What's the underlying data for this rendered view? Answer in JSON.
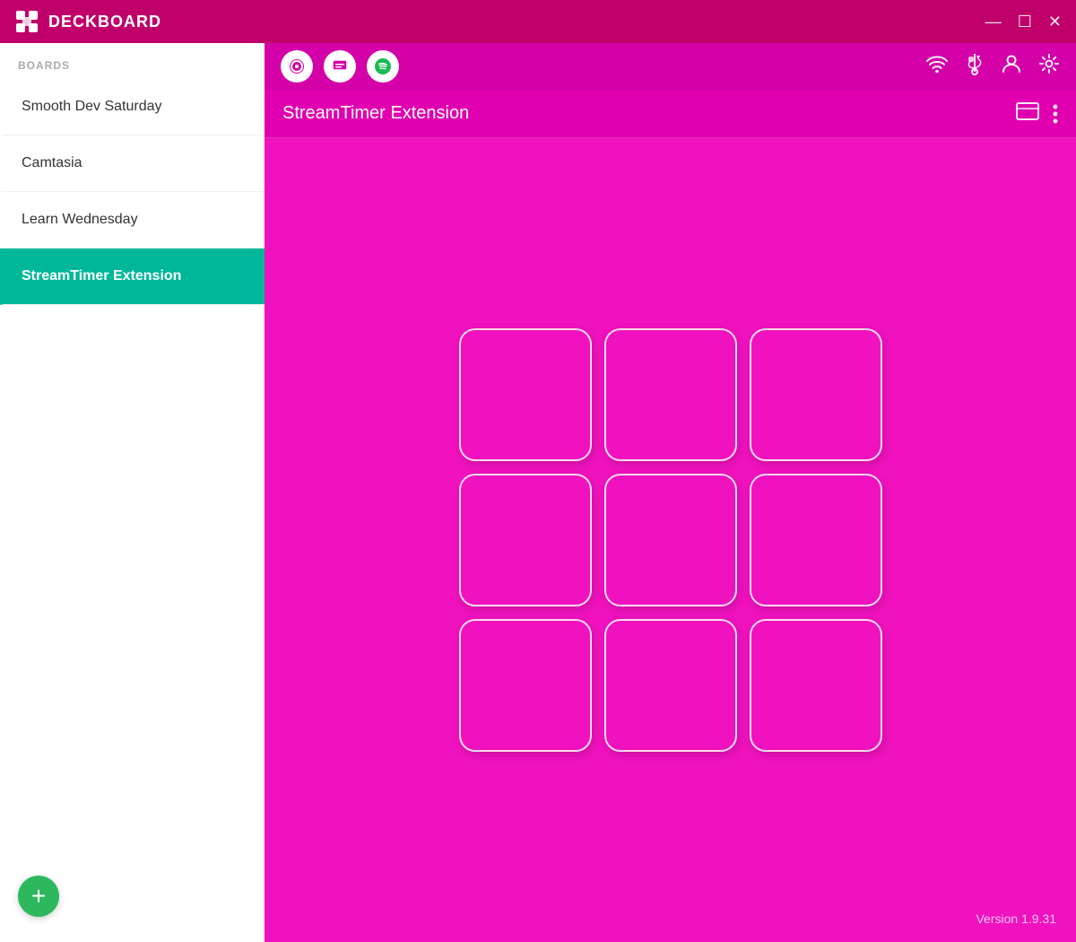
{
  "titlebar": {
    "app_name": "DECKBOARD",
    "controls": {
      "minimize": "—",
      "maximize": "☐",
      "close": "✕"
    }
  },
  "sidebar": {
    "section_label": "BOARDS",
    "items": [
      {
        "id": "smooth-dev-saturday",
        "label": "Smooth Dev Saturday",
        "active": false
      },
      {
        "id": "camtasia",
        "label": "Camtasia",
        "active": false
      },
      {
        "id": "learn-wednesday",
        "label": "Learn Wednesday",
        "active": false
      },
      {
        "id": "streamtimer-extension",
        "label": "StreamTimer Extension",
        "active": true
      }
    ],
    "add_button_label": "+"
  },
  "toolbar": {
    "icons": [
      {
        "id": "obs-icon",
        "symbol": "⊙"
      },
      {
        "id": "chat-icon",
        "symbol": "💬"
      },
      {
        "id": "spotify-icon",
        "symbol": "♫"
      }
    ],
    "right_icons": [
      {
        "id": "wifi-icon",
        "symbol": "wifi"
      },
      {
        "id": "usb-icon",
        "symbol": "usb"
      },
      {
        "id": "account-icon",
        "symbol": "person"
      },
      {
        "id": "settings-icon",
        "symbol": "gear"
      }
    ]
  },
  "board": {
    "title": "StreamTimer Extension",
    "grid_rows": 3,
    "grid_cols": 3,
    "total_buttons": 9
  },
  "version": {
    "label": "Version 1.9.31"
  },
  "colors": {
    "titlebar_bg": "#c0006a",
    "sidebar_bg": "#ffffff",
    "toolbar_bg": "#d400a8",
    "board_title_bg": "#e000b0",
    "content_bg": "#f012be",
    "active_item_bg": "#00b899",
    "add_btn_bg": "#2db85e"
  }
}
